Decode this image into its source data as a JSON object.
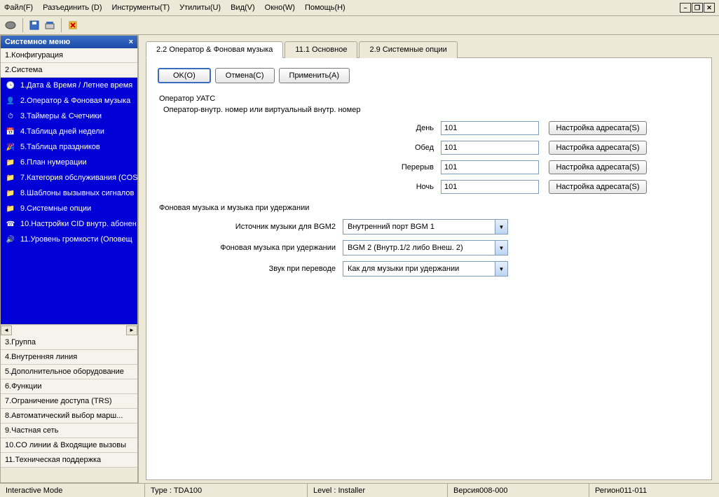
{
  "menu": {
    "file": "Файл(F)",
    "disconnect": "Разъединить (D)",
    "tools": "Инструменты(T)",
    "utilities": "Утилиты(U)",
    "view": "Вид(V)",
    "window": "Окно(W)",
    "help": "Помощь(H)"
  },
  "sidebar": {
    "title": "Системное меню",
    "items": {
      "config": "1.Конфигурация",
      "system": "2.Система",
      "group": "3.Группа",
      "extension": "4.Внутренняя линия",
      "optional": "5.Дополнительное оборудование",
      "functions": "6.Функции",
      "trs": "7.Ограничение доступа (TRS)",
      "ars": "8.Автоматический выбор марш...",
      "private": "9.Частная сеть",
      "co": "10.CO линии & Входящие вызовы",
      "maint": "11.Техническая поддержка"
    },
    "sub": {
      "s1": "1.Дата & Время / Летнее время",
      "s2": "2.Оператор & Фоновая музыка",
      "s3": "3.Таймеры & Счетчики",
      "s4": "4.Таблица дней недели",
      "s5": "5.Таблица праздников",
      "s6": "6.План нумерации",
      "s7": "7.Категория обслуживания (COS",
      "s8": "8.Шаблоны вызывных сигналов",
      "s9": "9.Системные опции",
      "s10": "10.Настройки CID внутр. абонен",
      "s11": "11.Уровень громкости (Оповещ"
    }
  },
  "tabs": {
    "t1": "2.2 Оператор & Фоновая музыка",
    "t2": "11.1 Основное",
    "t3": "2.9 Системные опции"
  },
  "buttons": {
    "ok": "OK(O)",
    "cancel": "Отмена(C)",
    "apply": "Применить(A)",
    "dest": "Настройка адресата(S)"
  },
  "form": {
    "grouptitle": "Оператор УАТС",
    "subtitle": "Оператор-внутр. номер или виртуальный внутр. номер",
    "day": {
      "label": "День",
      "value": "101"
    },
    "lunch": {
      "label": "Обед",
      "value": "101"
    },
    "break": {
      "label": "Перерыв",
      "value": "101"
    },
    "night": {
      "label": "Ночь",
      "value": "101"
    },
    "bgm_section": "Фоновая музыка и музыка при удержании",
    "bgm2": {
      "label": "Источник музыки для BGM2",
      "value": "Внутренний порт BGM 1"
    },
    "hold": {
      "label": "Фоновая музыка при удержании",
      "value": "BGM 2 (Внутр.1/2 либо Внеш. 2)"
    },
    "transfer": {
      "label": "Звук при переводе",
      "value": "Как для музыки при удержании"
    }
  },
  "status": {
    "mode": "Interactive Mode",
    "type": "Type : TDA100",
    "level": "Level : Installer",
    "version": "Версия008-000",
    "region": "Регион011-011"
  }
}
